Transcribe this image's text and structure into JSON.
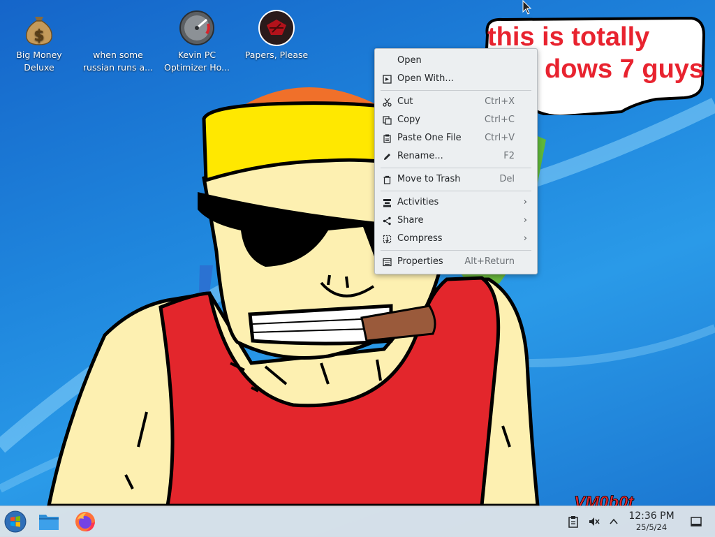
{
  "desktop": {
    "icons": [
      {
        "label": "Big Money Deluxe",
        "icon": "money-bag-icon"
      },
      {
        "label": "when some russian runs a...",
        "icon": "blank-file-icon"
      },
      {
        "label": "Kevin PC Optimizer Ho...",
        "icon": "speedometer-icon"
      },
      {
        "label": "Papers, Please",
        "icon": "papers-please-emblem-icon"
      }
    ],
    "speech_bubble": {
      "line1": "this is totally",
      "line2": "dows 7 guys"
    },
    "signature": "VM0b0t",
    "colors": {
      "speech_text": "#e8232f",
      "tank_top": "#e3262c",
      "headband": "#ffe800",
      "skin": "#fdf0b1"
    }
  },
  "context_menu": {
    "items": [
      {
        "label": "Open",
        "shortcut": "",
        "icon": "none"
      },
      {
        "label": "Open With...",
        "shortcut": "",
        "icon": "open-with-icon"
      },
      {
        "label": "Cut",
        "shortcut": "Ctrl+X",
        "icon": "scissors-icon"
      },
      {
        "label": "Copy",
        "shortcut": "Ctrl+C",
        "icon": "copy-icon"
      },
      {
        "label": "Paste One File",
        "shortcut": "Ctrl+V",
        "icon": "paste-icon"
      },
      {
        "label": "Rename...",
        "shortcut": "F2",
        "icon": "pencil-icon"
      },
      {
        "label": "Move to Trash",
        "shortcut": "Del",
        "icon": "trash-icon"
      },
      {
        "label": "Activities",
        "shortcut": "",
        "icon": "activities-icon",
        "submenu": true
      },
      {
        "label": "Share",
        "shortcut": "",
        "icon": "share-icon",
        "submenu": true
      },
      {
        "label": "Compress",
        "shortcut": "",
        "icon": "compress-icon",
        "submenu": true
      },
      {
        "label": "Properties",
        "shortcut": "Alt+Return",
        "icon": "properties-icon"
      }
    ]
  },
  "taskbar": {
    "launchers": [
      {
        "name": "start-menu",
        "icon": "windows-orb-icon"
      },
      {
        "name": "file-manager",
        "icon": "folder-icon"
      },
      {
        "name": "firefox",
        "icon": "firefox-icon"
      }
    ],
    "tray": {
      "clipboard": "clipboard-icon",
      "volume": "volume-muted-icon",
      "expand": "chevron-up-icon"
    },
    "clock": {
      "time": "12:36 PM",
      "date": "25/5/24"
    },
    "show_desktop": "show-desktop-icon"
  }
}
